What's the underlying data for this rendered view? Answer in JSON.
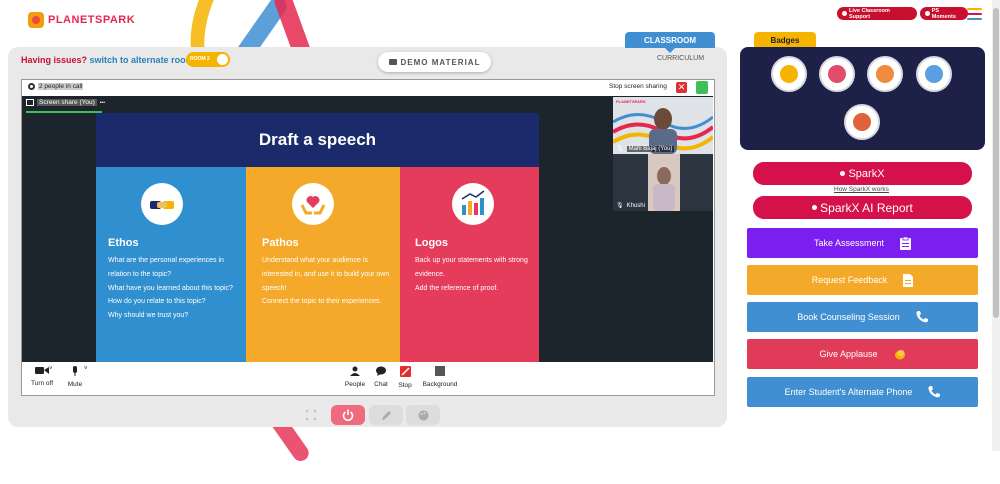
{
  "brand": {
    "logo_text": "PLANETSPARK"
  },
  "header": {
    "live_support_label": "Live Classroom Support",
    "ps_moments_label": "PS Moments",
    "menu_colors": [
      "#f5b400",
      "#d4114a",
      "#3f8fd2"
    ]
  },
  "classroom": {
    "issues_text": "Having issues?",
    "switch_text": "switch to alternate room",
    "room_toggle_label": "ROOM 2",
    "demo_material_label": "DEMO MATERIAL",
    "classroom_tab_label": "CLASSROOM",
    "curriculum_label": "CURRICULUM"
  },
  "call": {
    "people_in_call": "2 people in call",
    "stop_screen_sharing": "Stop screen sharing",
    "close_glyph": "✕",
    "screen_share_label": "Screen share (You)",
    "more_glyph": "•••",
    "participants": [
      {
        "name": "Mahi Bajaj (You)"
      },
      {
        "name": "Khushi"
      }
    ],
    "participant_brand": "PLANETSPARK"
  },
  "slide": {
    "title": "Draft a speech",
    "columns": [
      {
        "heading": "Ethos",
        "lines": [
          "What are the personal experiences in relation to the topic?",
          "What have you learned about this topic?",
          "How do you relate to this topic?",
          "Why should we trust you?"
        ],
        "color": "#2f8fcf"
      },
      {
        "heading": "Pathos",
        "lines": [
          "Understand what your audience is interested in, and use it to build your own speech!",
          "Connect the topic to their experiences."
        ],
        "color": "#f4a92a"
      },
      {
        "heading": "Logos",
        "lines": [
          "Back up your statements with strong evidence.",
          "Add the reference of proof."
        ],
        "color": "#e63c5c"
      }
    ]
  },
  "controls": {
    "turn_off": "Turn off",
    "mute": "Mute",
    "people": "People",
    "chat": "Chat",
    "stop": "Stop",
    "background": "Background"
  },
  "badges": {
    "tab_label": "Badges",
    "items": [
      {
        "icon": "trophy-icon",
        "color": "#f5b400"
      },
      {
        "icon": "robot-icon",
        "color": "#e04c6a"
      },
      {
        "icon": "globe-person-icon",
        "color": "#f08a3c"
      },
      {
        "icon": "lightbulb-icon",
        "color": "#5aa0e0"
      },
      {
        "icon": "rocket-icon",
        "color": "#e0623c"
      }
    ]
  },
  "sparkx": {
    "button_label": "SparkX",
    "how_link": "How SparkX works",
    "ai_report_label": "SparkX AI Report"
  },
  "actions": [
    {
      "label": "Take Assessment",
      "color": "#7b1ff0",
      "icon": "clipboard-icon"
    },
    {
      "label": "Request Feedback",
      "color": "#f5a92a",
      "icon": "document-icon"
    },
    {
      "label": "Book Counseling Session",
      "color": "#3f8fd2",
      "icon": "phone-icon"
    },
    {
      "label": "Give Applause",
      "color": "#e03c5a",
      "icon": "clap-icon"
    },
    {
      "label": "Enter Student's Alternate Phone",
      "color": "#3f8fd2",
      "icon": "phone-icon"
    }
  ]
}
